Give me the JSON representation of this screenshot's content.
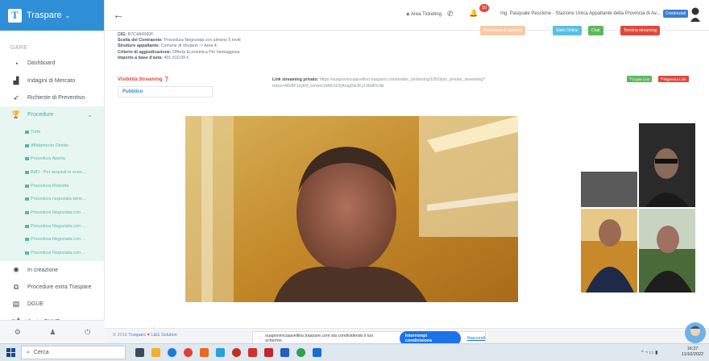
{
  "app": {
    "brand": "Traspare"
  },
  "sidebar": {
    "section": "GARE",
    "items": [
      {
        "label": "Dashboard",
        "icon": "dashboard-icon",
        "glyph": "◔"
      },
      {
        "label": "Indagini di Mercato",
        "icon": "chart-icon",
        "glyph": "▟"
      },
      {
        "label": "Richieste di Preventivo",
        "icon": "send-icon",
        "glyph": "➶"
      },
      {
        "label": "Procedure",
        "icon": "trophy-icon",
        "glyph": "🏆"
      }
    ],
    "sub_items": [
      "Tutte",
      "Affidamento Diretto",
      "Procedura Aperta",
      "BdO - Per acquisti in econ...",
      "Procedura Ristretta",
      "Procedura negoziata senz...",
      "Procedura Negoziata con ...",
      "Procedura Negoziata con ...",
      "Procedura Negoziata con ...",
      "Procedura Negoziata con ..."
    ],
    "items2": [
      {
        "label": "In creazione",
        "icon": "spinner-icon",
        "glyph": "✺"
      },
      {
        "label": "Procedure extra Traspare",
        "icon": "external-link-icon",
        "glyph": "⧉"
      },
      {
        "label": "DGUE",
        "icon": "document-icon",
        "glyph": "▤"
      },
      {
        "label": "Avvisi GUUE",
        "icon": "megaphone-icon",
        "glyph": "📢"
      }
    ]
  },
  "topbar": {
    "area": "Area Ticketing",
    "badge": "10",
    "user": "Ing. Pasquale Pescione - Stazione Unica Appaltante della Provincia di Av...",
    "credential": "Credenziali"
  },
  "buttons": [
    {
      "label": "Procedura di apertura",
      "color": "#f6c9a8"
    },
    {
      "label": "Stato Online",
      "color": "#5bc0de"
    },
    {
      "label": "Chat",
      "color": "#5cb85c"
    },
    {
      "label": "Termina streaming",
      "color": "#e0483e"
    }
  ],
  "details": {
    "cig_label": "CIG:",
    "cig": "B7C4A0060F",
    "scelta_label": "Scelta del Contraente:",
    "scelta": "Procedura Negoziata con almeno 5 inviti",
    "strutture_label": "Strutture appaltante:",
    "strutture": "Comune di Vitulano -> Area 4",
    "criterio_label": "Criterio di aggiudicazione:",
    "criterio": "Offerta Economica Più Vantaggiosa",
    "importo_label": "Importo a base d'asta:",
    "importo": "401.910,09 €"
  },
  "streaming": {
    "visibility_label": "Visibilità Streaming",
    "visibility_value": "Pubblico",
    "link_label": "Link streaming privato:",
    "link_url": "https://suaprovinciaavellino.traspare.com/tender_streaming/1052/join_private_streaming?",
    "token": "token=MX8PJeyR4_bmixm1dKKSDQKwgDik2Ky19bMDcNk",
    "copy_label": "Copia Link",
    "regen_label": "Rigenera Link"
  },
  "footer": {
    "copyright_prefix": "© 2016",
    "copyright_link": "Traspare",
    "copyright_suffix": "L&G Solution",
    "share_text": "suaprovinciaavellino.traspare.com sta condividendo il tuo schermo.",
    "stop_share": "Interrompi condivisione",
    "hide": "Nascondi"
  },
  "taskbar": {
    "search": "Cerca",
    "time": "16:27",
    "date": "11/10/2022"
  },
  "colors": {
    "brand": "#2f8fd6",
    "accent": "#36b59a",
    "danger": "#e0483e"
  }
}
